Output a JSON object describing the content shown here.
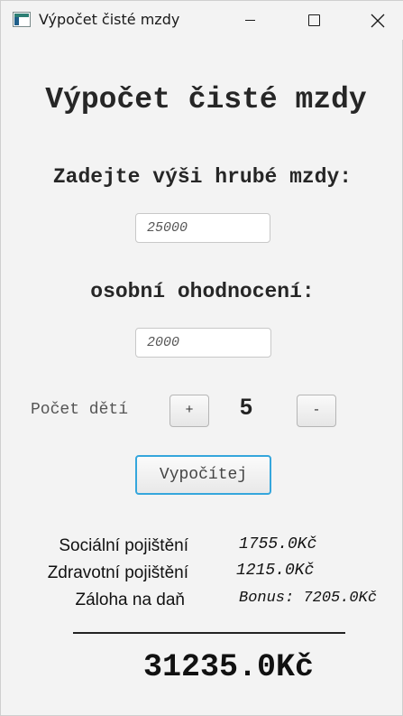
{
  "window": {
    "title": "Výpočet čisté mzdy",
    "icon": "java-app-icon"
  },
  "heading": "Výpočet čisté mzdy",
  "gross": {
    "label": "Zadejte výši hrubé mzdy:",
    "value": "25000"
  },
  "bonus": {
    "label": "osobní ohodnocení:",
    "value": "2000"
  },
  "children": {
    "label": "Počet dětí",
    "plus_label": "+",
    "count": "5",
    "minus_label": "-"
  },
  "calculate_label": "Vypočítej",
  "results": {
    "social": {
      "label": "Sociální pojištění",
      "value": "1755.0Kč"
    },
    "health": {
      "label": "Zdravotní pojištění",
      "value": "1215.0Kč"
    },
    "tax": {
      "label": "Záloha na daň",
      "value": "Bonus: 7205.0Kč"
    }
  },
  "net_total": "31235.0Kč",
  "colors": {
    "background": "#f3f3f3",
    "focus_accent": "#35a6dc"
  }
}
